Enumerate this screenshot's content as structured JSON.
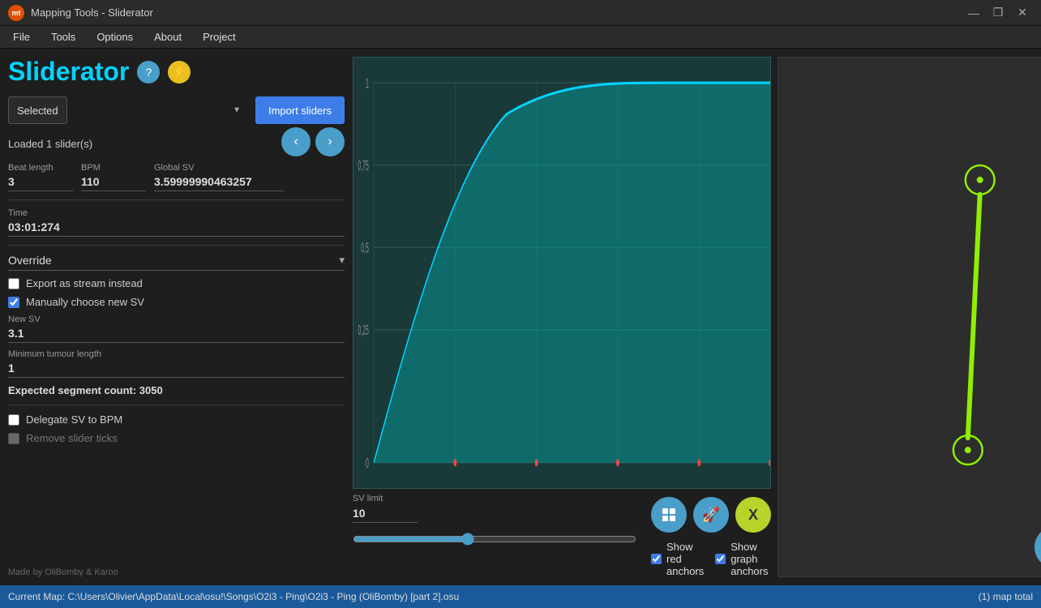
{
  "titlebar": {
    "logo_text": "mt",
    "title": "Mapping Tools - Sliderator",
    "minimize": "—",
    "restore": "❐",
    "close": "✕"
  },
  "menubar": {
    "items": [
      "File",
      "Tools",
      "Options",
      "About",
      "Project"
    ]
  },
  "app": {
    "title": "Sliderator",
    "help_icon": "?",
    "lightning_icon": "⚡"
  },
  "selected": {
    "label": "Selected",
    "dropdown_value": "Selected",
    "import_button": "Import sliders"
  },
  "loaded": {
    "text": "Loaded 1 slider(s)"
  },
  "nav": {
    "prev": "‹",
    "next": "›"
  },
  "beat_length": {
    "label": "Beat length",
    "value": "3"
  },
  "bpm": {
    "label": "BPM",
    "value": "110"
  },
  "global_sv": {
    "label": "Global SV",
    "value": "3.59999990463257"
  },
  "time": {
    "label": "Time",
    "value": "03:01:274"
  },
  "override": {
    "label": "Override"
  },
  "export_stream": {
    "label": "Export as stream instead",
    "checked": false
  },
  "manually_choose_sv": {
    "label": "Manually choose new SV",
    "checked": true
  },
  "new_sv": {
    "label": "New SV",
    "value": "3.1"
  },
  "min_tumour": {
    "label": "Minimum tumour length",
    "value": "1"
  },
  "expected_segment": {
    "text": "Expected segment count: 3050"
  },
  "delegate_sv": {
    "label": "Delegate SV to BPM",
    "checked": false
  },
  "remove_ticks": {
    "label": "Remove slider ticks",
    "checked": false,
    "disabled": true
  },
  "made_by": {
    "text": "Made by OliBomby & Karoo"
  },
  "sv_limit": {
    "label": "SV limit",
    "value": "10",
    "slider_value": 40
  },
  "actions": {
    "grid_icon": "⊞",
    "rocket_icon": "🚀",
    "x_label": "X"
  },
  "anchors": {
    "show_red_label": "Show red anchors",
    "show_red_checked": true,
    "show_graph_label": "Show graph anchors",
    "show_graph_checked": true
  },
  "statusbar": {
    "current_map": "Current Map: C:\\Users\\Olivier\\AppData\\Local\\osu!\\Songs\\O2i3 - Ping\\O2i3 - Ping (OliBomby) [part 2].osu",
    "map_total": "(1) map total"
  },
  "chart": {
    "y_labels": [
      "1",
      "0,75",
      "0,5",
      "0,25",
      "0"
    ],
    "bg_color": "#1a3a3a"
  }
}
